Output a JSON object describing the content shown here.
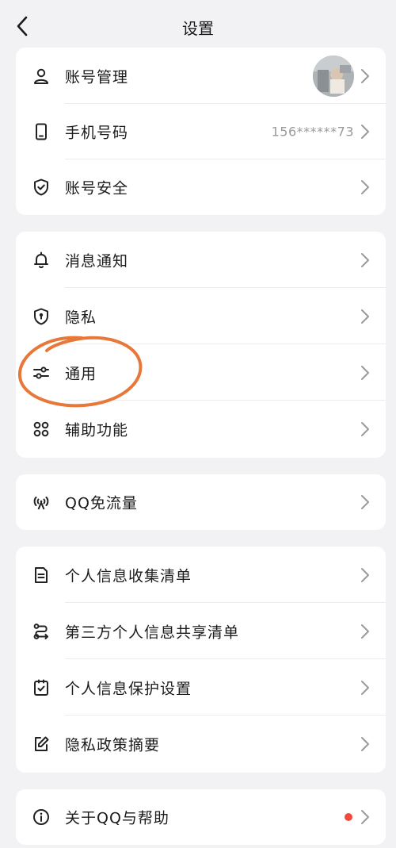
{
  "header": {
    "title": "设置"
  },
  "colors": {
    "accent_red": "#f04a3c",
    "annotation_orange": "#e8783a"
  },
  "sections": [
    {
      "items": [
        {
          "label": "账号管理",
          "icon": "person-icon",
          "value": ""
        },
        {
          "label": "手机号码",
          "icon": "phone-icon",
          "value": "156******73"
        },
        {
          "label": "账号安全",
          "icon": "shield-check-icon",
          "value": ""
        }
      ]
    },
    {
      "items": [
        {
          "label": "消息通知",
          "icon": "bell-icon"
        },
        {
          "label": "隐私",
          "icon": "privacy-shield-icon"
        },
        {
          "label": "通用",
          "icon": "sliders-icon"
        },
        {
          "label": "辅助功能",
          "icon": "command-icon"
        }
      ]
    },
    {
      "items": [
        {
          "label": "QQ免流量",
          "icon": "signal-tower-icon"
        }
      ]
    },
    {
      "items": [
        {
          "label": "个人信息收集清单",
          "icon": "document-icon"
        },
        {
          "label": "第三方个人信息共享清单",
          "icon": "share-route-icon"
        },
        {
          "label": "个人信息保护设置",
          "icon": "checkbox-doc-icon"
        },
        {
          "label": "隐私政策摘要",
          "icon": "edit-icon"
        }
      ]
    },
    {
      "items": [
        {
          "label": "关于QQ与帮助",
          "icon": "info-icon"
        }
      ]
    }
  ]
}
